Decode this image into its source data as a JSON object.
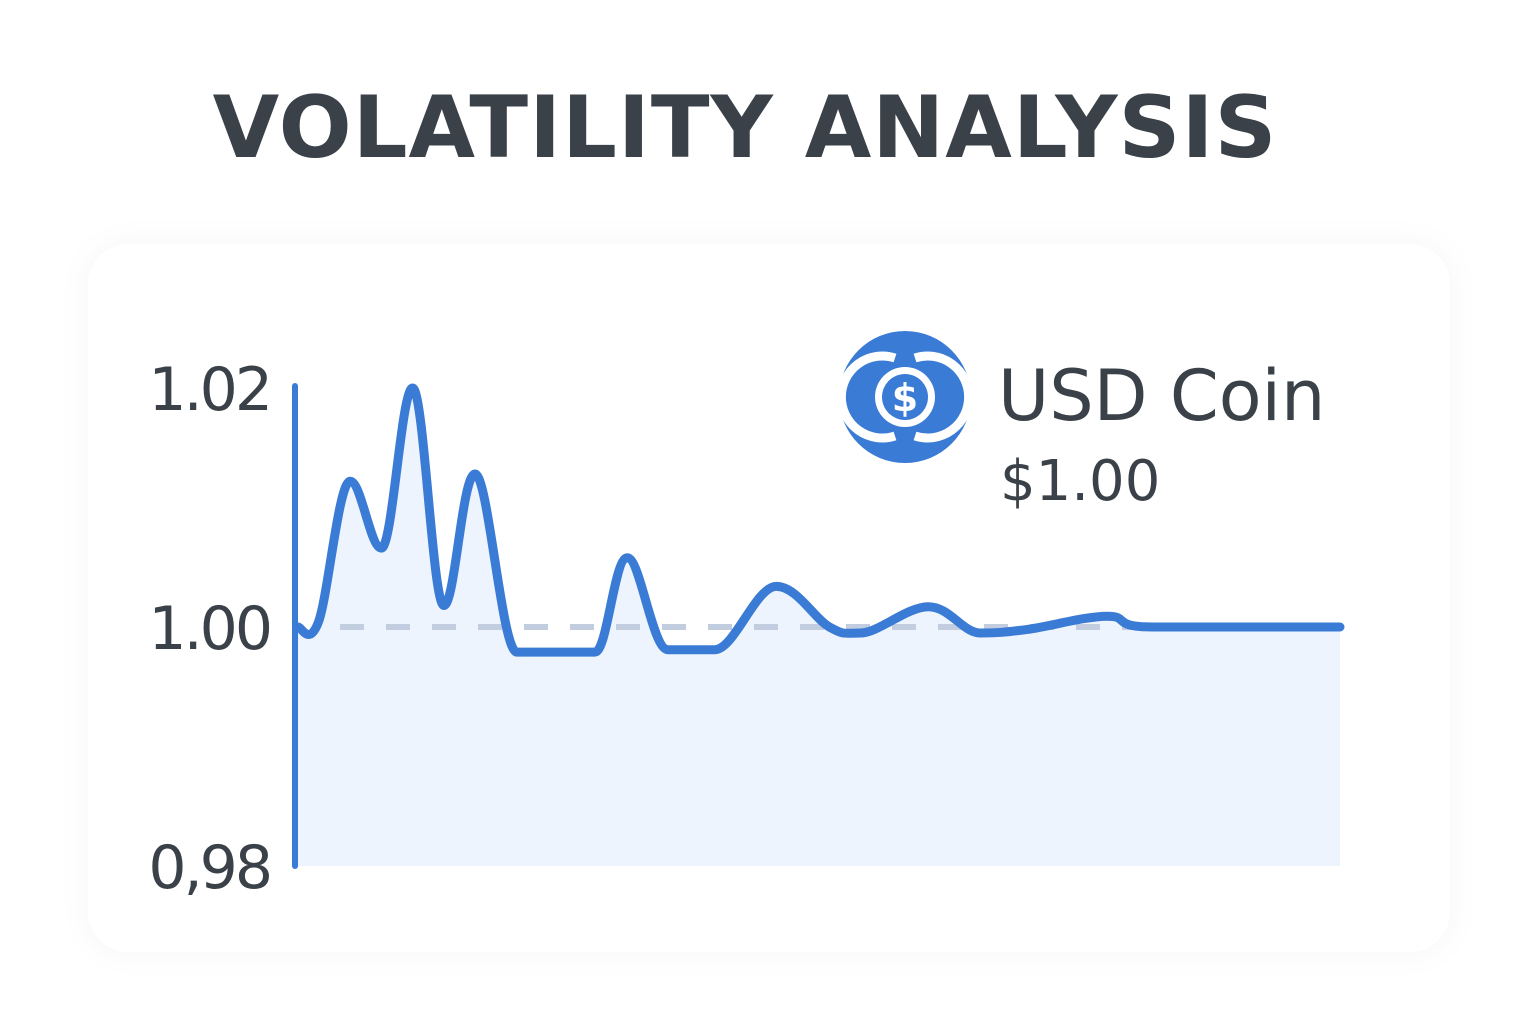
{
  "title": "VOLATILITY ANALYSIS",
  "legend": {
    "name": "USD Coin",
    "price": "$1.00",
    "icon": "usd-coin-icon"
  },
  "colors": {
    "line": "#3a7bd5",
    "fill": "#eef4fd",
    "baseline": "#c3cde0",
    "text": "#3a4148",
    "logo": "#3a7bd5"
  },
  "chart_data": {
    "type": "line",
    "title": "VOLATILITY ANALYSIS",
    "xlabel": "",
    "ylabel": "",
    "ylim": [
      0.98,
      1.02
    ],
    "y_ticks": [
      1.02,
      1.0,
      0.98
    ],
    "y_tick_labels": [
      "1.02",
      "1.00",
      "0,98"
    ],
    "xlim": [
      0,
      100
    ],
    "reference_line": 1.0,
    "grid": false,
    "legend_position": "top-right",
    "series": [
      {
        "points": [
          [
            0,
            1.0
          ],
          [
            2,
            1.0005
          ],
          [
            5,
            1.0122
          ],
          [
            8,
            1.0066
          ],
          [
            11,
            1.02
          ],
          [
            14,
            1.0018
          ],
          [
            17,
            1.0128
          ],
          [
            21,
            0.9979
          ],
          [
            25,
            0.9979
          ],
          [
            28.5,
            0.9979
          ],
          [
            31.6,
            1.0058
          ],
          [
            35.5,
            0.9981
          ],
          [
            40,
            0.9981
          ],
          [
            45.9,
            1.0034
          ],
          [
            51,
            1.0
          ],
          [
            54,
            0.9995
          ],
          [
            60.5,
            1.0017
          ],
          [
            65.5,
            0.9995
          ],
          [
            70,
            0.9998
          ],
          [
            77.7,
            1.0009
          ],
          [
            82,
            1.0
          ],
          [
            100,
            1.0
          ]
        ]
      }
    ]
  }
}
